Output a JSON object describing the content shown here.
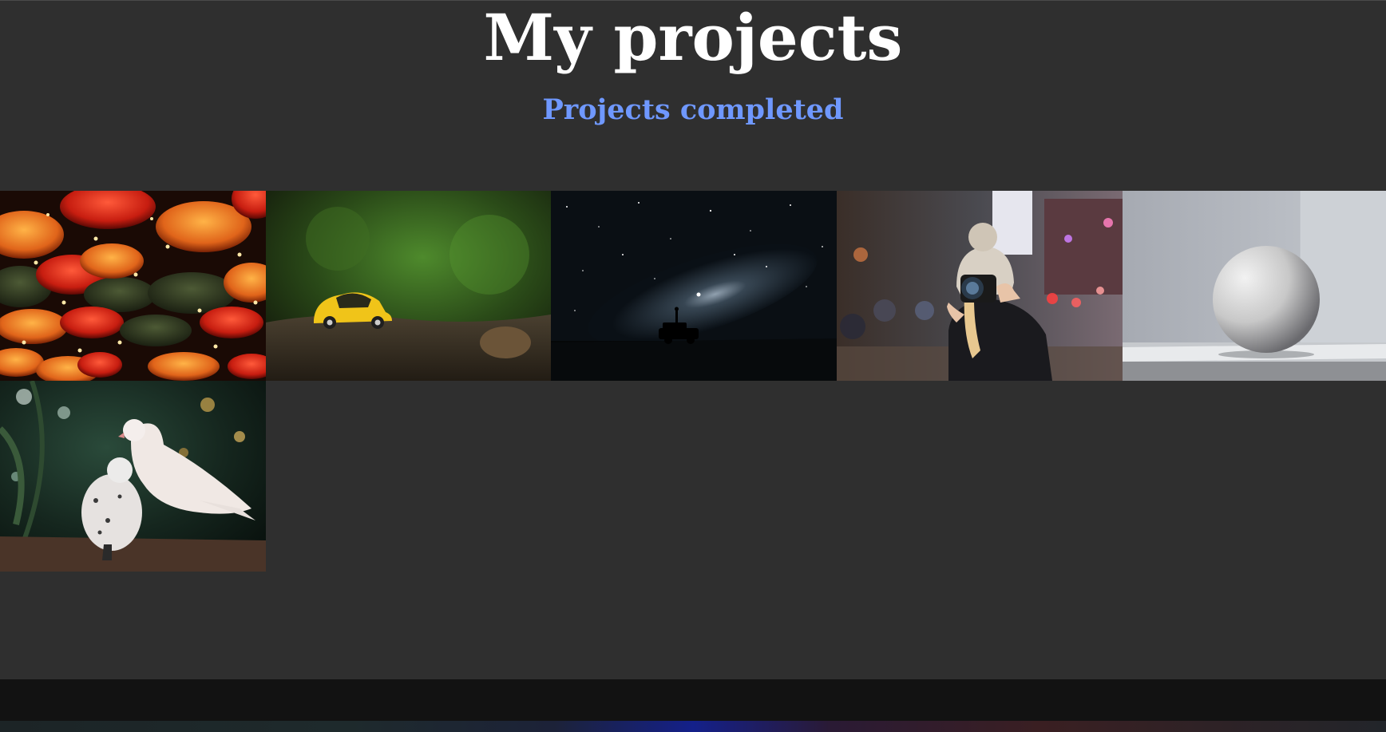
{
  "header": {
    "title": "My projects",
    "subtitle": "Projects completed"
  },
  "gallery": {
    "photos": [
      {
        "name": "umbrellas-photo"
      },
      {
        "name": "yellow-car-photo"
      },
      {
        "name": "night-sky-photo"
      },
      {
        "name": "photographer-photo"
      },
      {
        "name": "sphere-photo"
      },
      {
        "name": "doves-photo"
      }
    ]
  },
  "colors": {
    "background": "#2f2f2f",
    "title": "#ffffff",
    "subtitle_accent": "#6f98ff",
    "footer": "#121212"
  }
}
